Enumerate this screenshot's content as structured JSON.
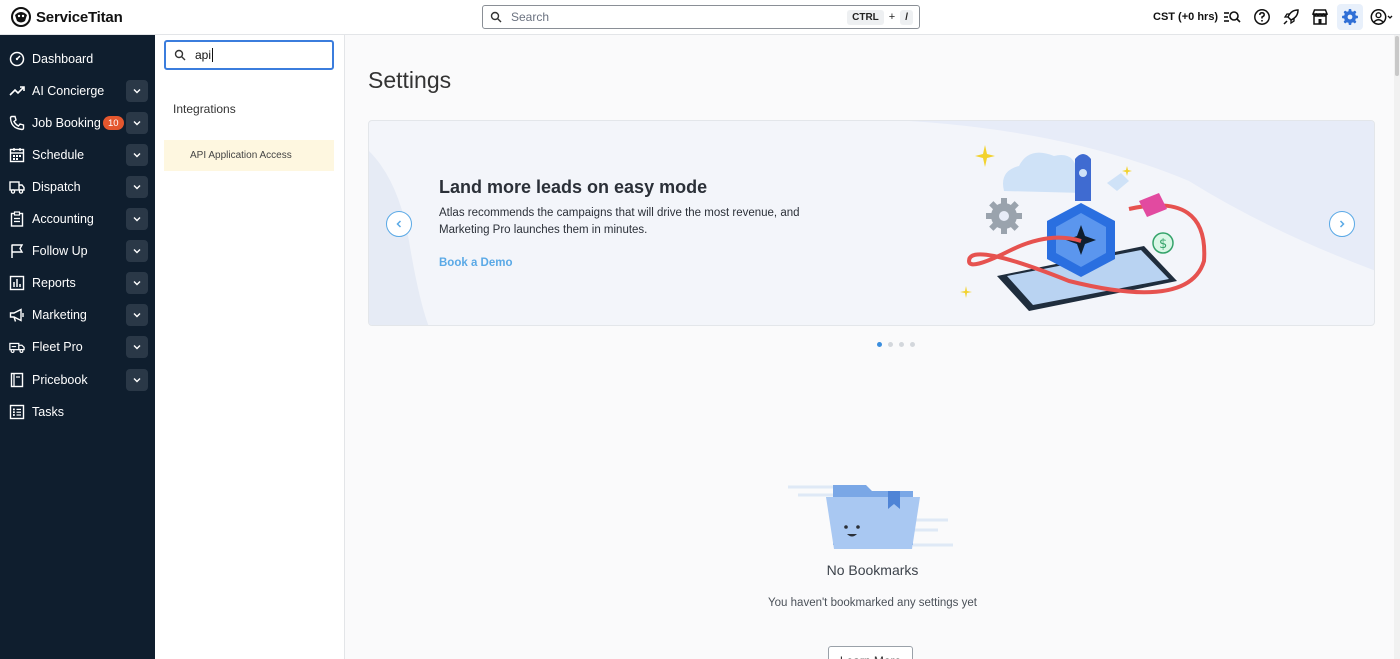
{
  "brand": {
    "name": "ServiceTitan"
  },
  "header": {
    "search_placeholder": "Search",
    "shortcut_key1": "CTRL",
    "shortcut_plus": "+",
    "shortcut_key2": "/",
    "timezone": "CST (+0 hrs)",
    "icons": [
      "search-list-icon",
      "help-icon",
      "rocket-icon",
      "store-icon",
      "gear-icon",
      "account-icon"
    ]
  },
  "sidebar": {
    "items": [
      {
        "label": "Dashboard",
        "icon": "dashboard-icon"
      },
      {
        "label": "AI Concierge",
        "icon": "trend-icon"
      },
      {
        "label": "Job Booking",
        "icon": "phone-icon",
        "badge": "10"
      },
      {
        "label": "Schedule",
        "icon": "calendar-icon"
      },
      {
        "label": "Dispatch",
        "icon": "truck-icon"
      },
      {
        "label": "Accounting",
        "icon": "clipboard-icon"
      },
      {
        "label": "Follow Up",
        "icon": "flag-icon"
      },
      {
        "label": "Reports",
        "icon": "chart-icon"
      },
      {
        "label": "Marketing",
        "icon": "megaphone-icon"
      },
      {
        "label": "Fleet Pro",
        "icon": "fleet-icon"
      },
      {
        "label": "Pricebook",
        "icon": "book-icon"
      },
      {
        "label": "Tasks",
        "icon": "tasks-icon"
      }
    ]
  },
  "settings_search": {
    "value": "api",
    "group": "Integrations",
    "results": [
      "API Application Access"
    ]
  },
  "main": {
    "title": "Settings",
    "banner": {
      "title": "Land more leads on easy mode",
      "description": "Atlas recommends the campaigns that will drive the most revenue, and Marketing Pro launches them in minutes.",
      "link": "Book a Demo",
      "slide_count": 4,
      "active_slide": 1
    },
    "empty_state": {
      "title": "No Bookmarks",
      "subtitle": "You haven't bookmarked any settings yet",
      "button": "Learn More"
    }
  },
  "colors": {
    "sidebar_bg": "#0f1e2e",
    "accent": "#3b7ddd",
    "link": "#5aa9e6",
    "badge": "#e4572e",
    "highlight": "#fef7e0"
  }
}
